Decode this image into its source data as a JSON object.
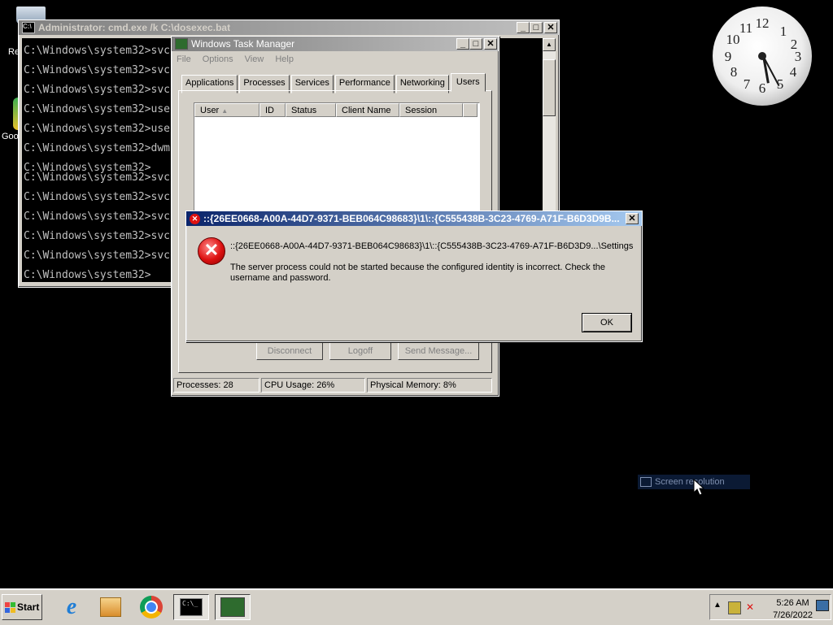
{
  "desktop": {
    "recycle_label": "Re",
    "chrome_label": "Goo"
  },
  "cmd_window": {
    "title": "Administrator: cmd.exe /k C:\\dosexec.bat",
    "lines": [
      "C:\\Windows\\system32>svc",
      "C:\\Windows\\system32>svc",
      "C:\\Windows\\system32>svc",
      "C:\\Windows\\system32>use",
      "C:\\Windows\\system32>use",
      "C:\\Windows\\system32>dwm",
      "C:\\Windows\\system32>",
      "C:\\Windows\\system32>svc",
      "C:\\Windows\\system32>svc",
      "C:\\Windows\\system32>svc",
      "C:\\Windows\\system32>svc",
      "C:\\Windows\\system32>svc",
      "C:\\Windows\\system32>"
    ]
  },
  "task_manager": {
    "title": "Windows Task Manager",
    "menu": [
      "File",
      "Options",
      "View",
      "Help"
    ],
    "tabs": [
      "Applications",
      "Processes",
      "Services",
      "Performance",
      "Networking",
      "Users"
    ],
    "selected_tab": "Users",
    "columns": [
      "User",
      "ID",
      "Status",
      "Client Name",
      "Session"
    ],
    "buttons": {
      "disconnect": "Disconnect",
      "logoff": "Logoff",
      "send_message": "Send Message..."
    },
    "status": {
      "processes": "Processes: 28",
      "cpu": "CPU Usage: 26%",
      "memory": "Physical Memory: 8%"
    }
  },
  "error_dialog": {
    "title": "::{26EE0668-A00A-44D7-9371-BEB064C98683}\\1\\::{C555438B-3C23-4769-A71F-B6D3D9B...",
    "path": "::{26EE0668-A00A-44D7-9371-BEB064C98683}\\1\\::{C555438B-3C23-4769-A71F-B6D3D9...\\Settings",
    "message": "The server process could not be started because the configured identity is incorrect. Check the username and password.",
    "ok_label": "OK"
  },
  "ghost_item": {
    "label": "Screen resolution"
  },
  "taskbar": {
    "start_label": "Start",
    "apps": [
      "internet-explorer",
      "windows-media",
      "chrome",
      "cmd",
      "task-manager"
    ],
    "time": "5:26 AM",
    "date": "7/26/2022"
  }
}
